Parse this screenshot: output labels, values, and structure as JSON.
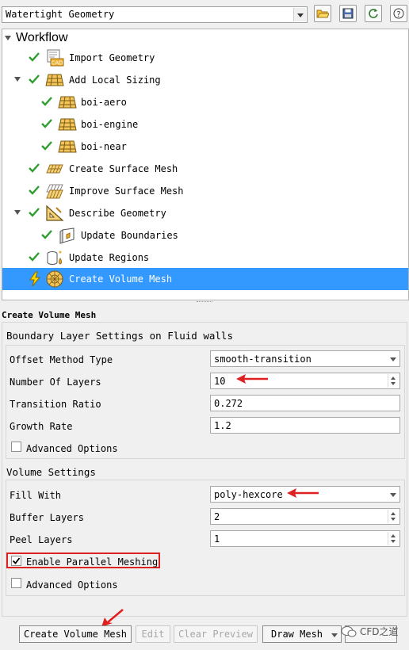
{
  "workflow_type": {
    "selected": "Watertight Geometry"
  },
  "toolbar_icons": [
    "open-folder-icon",
    "save-icon",
    "refresh-icon",
    "help-icon"
  ],
  "tree": {
    "title": "Workflow",
    "items": [
      {
        "label": "Import Geometry",
        "icon": "cad-import-icon",
        "status": "done"
      },
      {
        "label": "Add Local Sizing",
        "icon": "mesh-grid-icon",
        "status": "done",
        "expanded": true
      },
      {
        "label": "boi-aero",
        "icon": "mesh-grid-icon",
        "status": "done"
      },
      {
        "label": "boi-engine",
        "icon": "mesh-grid-icon",
        "status": "done"
      },
      {
        "label": "boi-near",
        "icon": "mesh-grid-icon",
        "status": "done"
      },
      {
        "label": "Create Surface Mesh",
        "icon": "surface-mesh-icon",
        "status": "done"
      },
      {
        "label": "Improve Surface Mesh",
        "icon": "surface-mesh-icon",
        "status": "done"
      },
      {
        "label": "Describe Geometry",
        "icon": "geometry-triangle-icon",
        "status": "done",
        "expanded": true
      },
      {
        "label": "Update Boundaries",
        "icon": "boundary-icon",
        "status": "done"
      },
      {
        "label": "Update Regions",
        "icon": "regions-icon",
        "status": "done"
      },
      {
        "label": "Create Volume Mesh",
        "icon": "volume-mesh-icon",
        "status": "pending",
        "selected": true
      }
    ]
  },
  "panel": {
    "title": "Create Volume Mesh",
    "boundary_layer": {
      "heading": "Boundary Layer Settings on Fluid walls",
      "offset_method_label": "Offset Method Type",
      "offset_method_value": "smooth-transition",
      "num_layers_label": "Number Of Layers",
      "num_layers_value": "10",
      "transition_ratio_label": "Transition Ratio",
      "transition_ratio_value": "0.272",
      "growth_rate_label": "Growth Rate",
      "growth_rate_value": "1.2",
      "advanced_label": "Advanced Options"
    },
    "volume": {
      "heading": "Volume Settings",
      "fill_with_label": "Fill With",
      "fill_with_value": "poly-hexcore",
      "buffer_layers_label": "Buffer Layers",
      "buffer_layers_value": "2",
      "peel_layers_label": "Peel Layers",
      "peel_layers_value": "1",
      "parallel_label": "Enable Parallel Meshing",
      "parallel_checked": true,
      "advanced_label": "Advanced Options"
    }
  },
  "buttons": {
    "create": "Create Volume Mesh",
    "edit": "Edit",
    "clear": "Clear Preview",
    "draw": "Draw Mesh"
  },
  "watermark": "CFD之道",
  "colors": {
    "selection": "#3399ff",
    "check": "#2e9e2e",
    "annotation": "#e02020"
  }
}
